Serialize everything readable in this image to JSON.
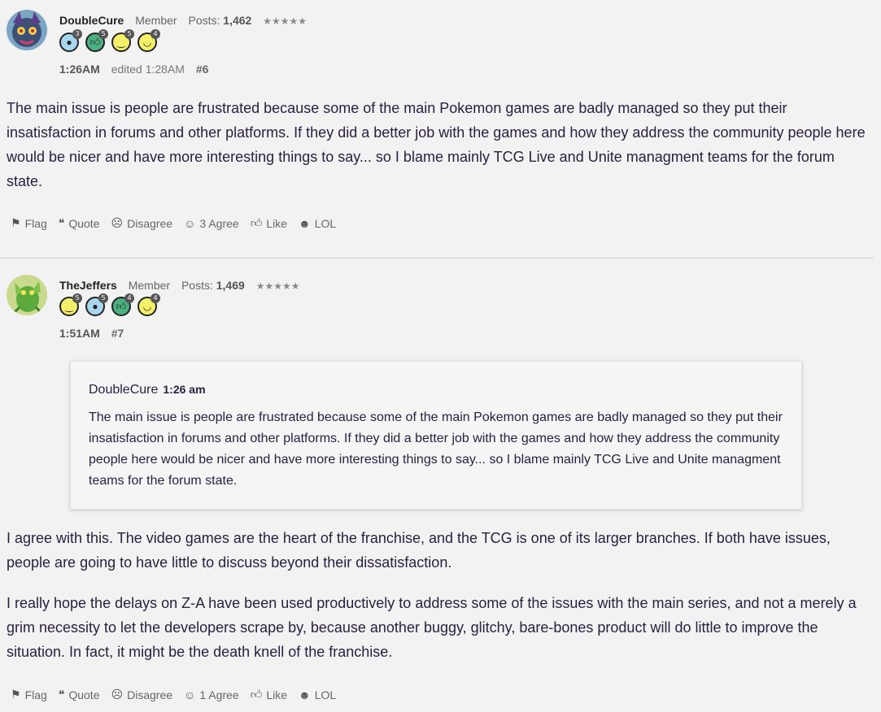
{
  "posts": [
    {
      "author": "DoubleCure",
      "role": "Member",
      "posts_label": "Posts:",
      "posts_count": "1,462",
      "stars": "★★★★★",
      "badges": [
        {
          "icon": "speech-bubble-icon",
          "count": "3"
        },
        {
          "icon": "thumbs-up-icon",
          "count": "5"
        },
        {
          "icon": "smile-icon",
          "count": "5"
        },
        {
          "icon": "laugh-icon",
          "count": "4"
        }
      ],
      "time": "1:26AM",
      "edited": "edited 1:28AM",
      "number": "#6",
      "paragraphs": [
        "The main issue is people are frustrated because some of the main Pokemon games are badly managed so they put their insatisfaction in forums and other platforms. If they did a better job with the games and how they address the community people here would be nicer and have more interesting things to say... so I blame mainly TCG Live and Unite managment teams for the forum state."
      ],
      "reactions": {
        "flag": "Flag",
        "quote": "Quote",
        "disagree": "Disagree",
        "agree": "3 Agree",
        "like": "Like",
        "lol": "LOL"
      }
    },
    {
      "author": "TheJeffers",
      "role": "Member",
      "posts_label": "Posts:",
      "posts_count": "1,469",
      "stars": "★★★★★",
      "badges": [
        {
          "icon": "smile-icon",
          "count": "5"
        },
        {
          "icon": "speech-bubble-icon",
          "count": "5"
        },
        {
          "icon": "thumbs-up-icon",
          "count": "4"
        },
        {
          "icon": "laugh-icon",
          "count": "4"
        }
      ],
      "time": "1:51AM",
      "number": "#7",
      "quote": {
        "author": "DoubleCure",
        "time": "1:26 am",
        "text": "The main issue is people are frustrated because some of the main Pokemon games are badly managed so they put their insatisfaction in forums and other platforms. If they did a better job with the games and how they address the community people here would be nicer and have more interesting things to say... so I blame mainly TCG Live and Unite managment teams for the forum state."
      },
      "paragraphs": [
        "I agree with this. The video games are the heart of the franchise, and the TCG is one of its larger branches. If both have issues, people are going to have little to discuss beyond their dissatisfaction.",
        "I really hope the delays on Z-A have been used productively to address some of the issues with the main series, and not a merely a grim necessity to let the developers scrape by, because another buggy, glitchy, bare-bones product will do little to improve the situation. In fact, it might be the death knell of the franchise."
      ],
      "reactions": {
        "flag": "Flag",
        "quote": "Quote",
        "disagree": "Disagree",
        "agree": "1 Agree",
        "like": "Like",
        "lol": "LOL"
      }
    }
  ]
}
